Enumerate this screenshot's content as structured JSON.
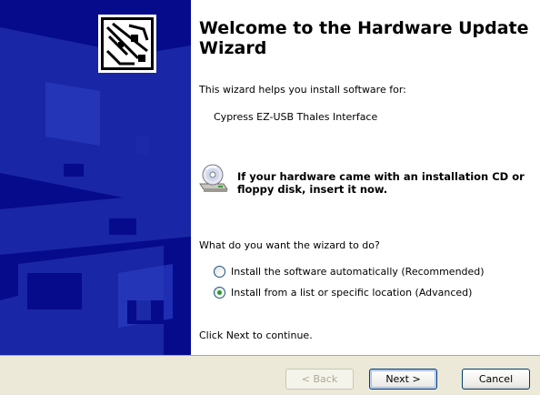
{
  "wizard": {
    "title": "Welcome to the Hardware Update Wizard",
    "intro": "This wizard helps you install software for:",
    "device_name": "Cypress EZ-USB Thales Interface",
    "cd_message": "If your hardware came with an installation CD or floppy disk, insert it now.",
    "question": "What do you want the wizard to do?",
    "options": [
      {
        "label": "Install the software automatically (Recommended)",
        "selected": false
      },
      {
        "label": "Install from a list or specific location (Advanced)",
        "selected": true
      }
    ],
    "continue_text": "Click Next to continue."
  },
  "buttons": {
    "back": "< Back",
    "next": "Next >",
    "cancel": "Cancel"
  },
  "colors": {
    "side_panel": "#060b8c",
    "button_bar": "#ece9d8",
    "radio_dot": "#21a121"
  },
  "icons": {
    "hardware": "hardware-card-icon",
    "cd": "cd-drive-icon"
  }
}
